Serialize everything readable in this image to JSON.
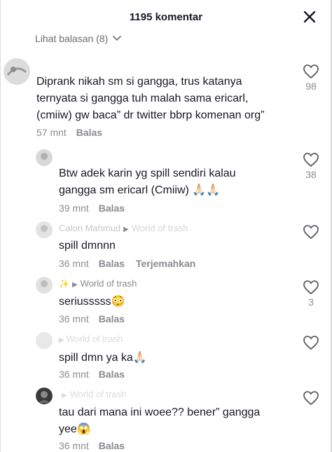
{
  "header": {
    "title": "1195 komentar"
  },
  "view_replies": {
    "label": "Lihat balasan (8)"
  },
  "comments": [
    {
      "username": "",
      "text_lines": [
        "Diprank nikah sm si gangga, trus katanya",
        "ternyata si gangga tuh malah sama ericarl,",
        "(cmiiw) gw baca” dr twitter bbrp komenan org”"
      ],
      "time": "57 mnt",
      "reply_label": "Balas",
      "likes": "98"
    },
    {
      "username": "",
      "text_lines": [
        "Btw adek karin yg spill sendiri kalau",
        "gangga sm ericarl (Cmiiw) 🙏🏻🙏🏻"
      ],
      "time": "39 mnt",
      "reply_label": "Balas",
      "likes": "38"
    },
    {
      "username": "Calon Mahmud",
      "reply_to": "World of trash",
      "text_lines": [
        "spill dmnnn"
      ],
      "time": "36 mnt",
      "reply_label": "Balas",
      "translate_label": "Terjemahkan",
      "likes": ""
    },
    {
      "username": "",
      "reply_to": "World of trash",
      "text_lines": [
        "seriusssss😳"
      ],
      "time": "36 mnt",
      "reply_label": "Balas",
      "likes": "3"
    },
    {
      "username": "World of trash",
      "text_lines": [
        "spill dmn ya ka🙏🏻"
      ],
      "time": "36 mnt",
      "reply_label": "Balas",
      "likes": ""
    },
    {
      "username": "",
      "reply_to": "World of trash",
      "text_lines": [
        "tau dari mana ini woee?? bener” gangga",
        "yee😱"
      ],
      "time": "36 mnt",
      "reply_label": "Balas",
      "likes": ""
    }
  ],
  "colors": {
    "text": "#161823",
    "muted": "#8a8b91",
    "bg": "#ffffff"
  }
}
